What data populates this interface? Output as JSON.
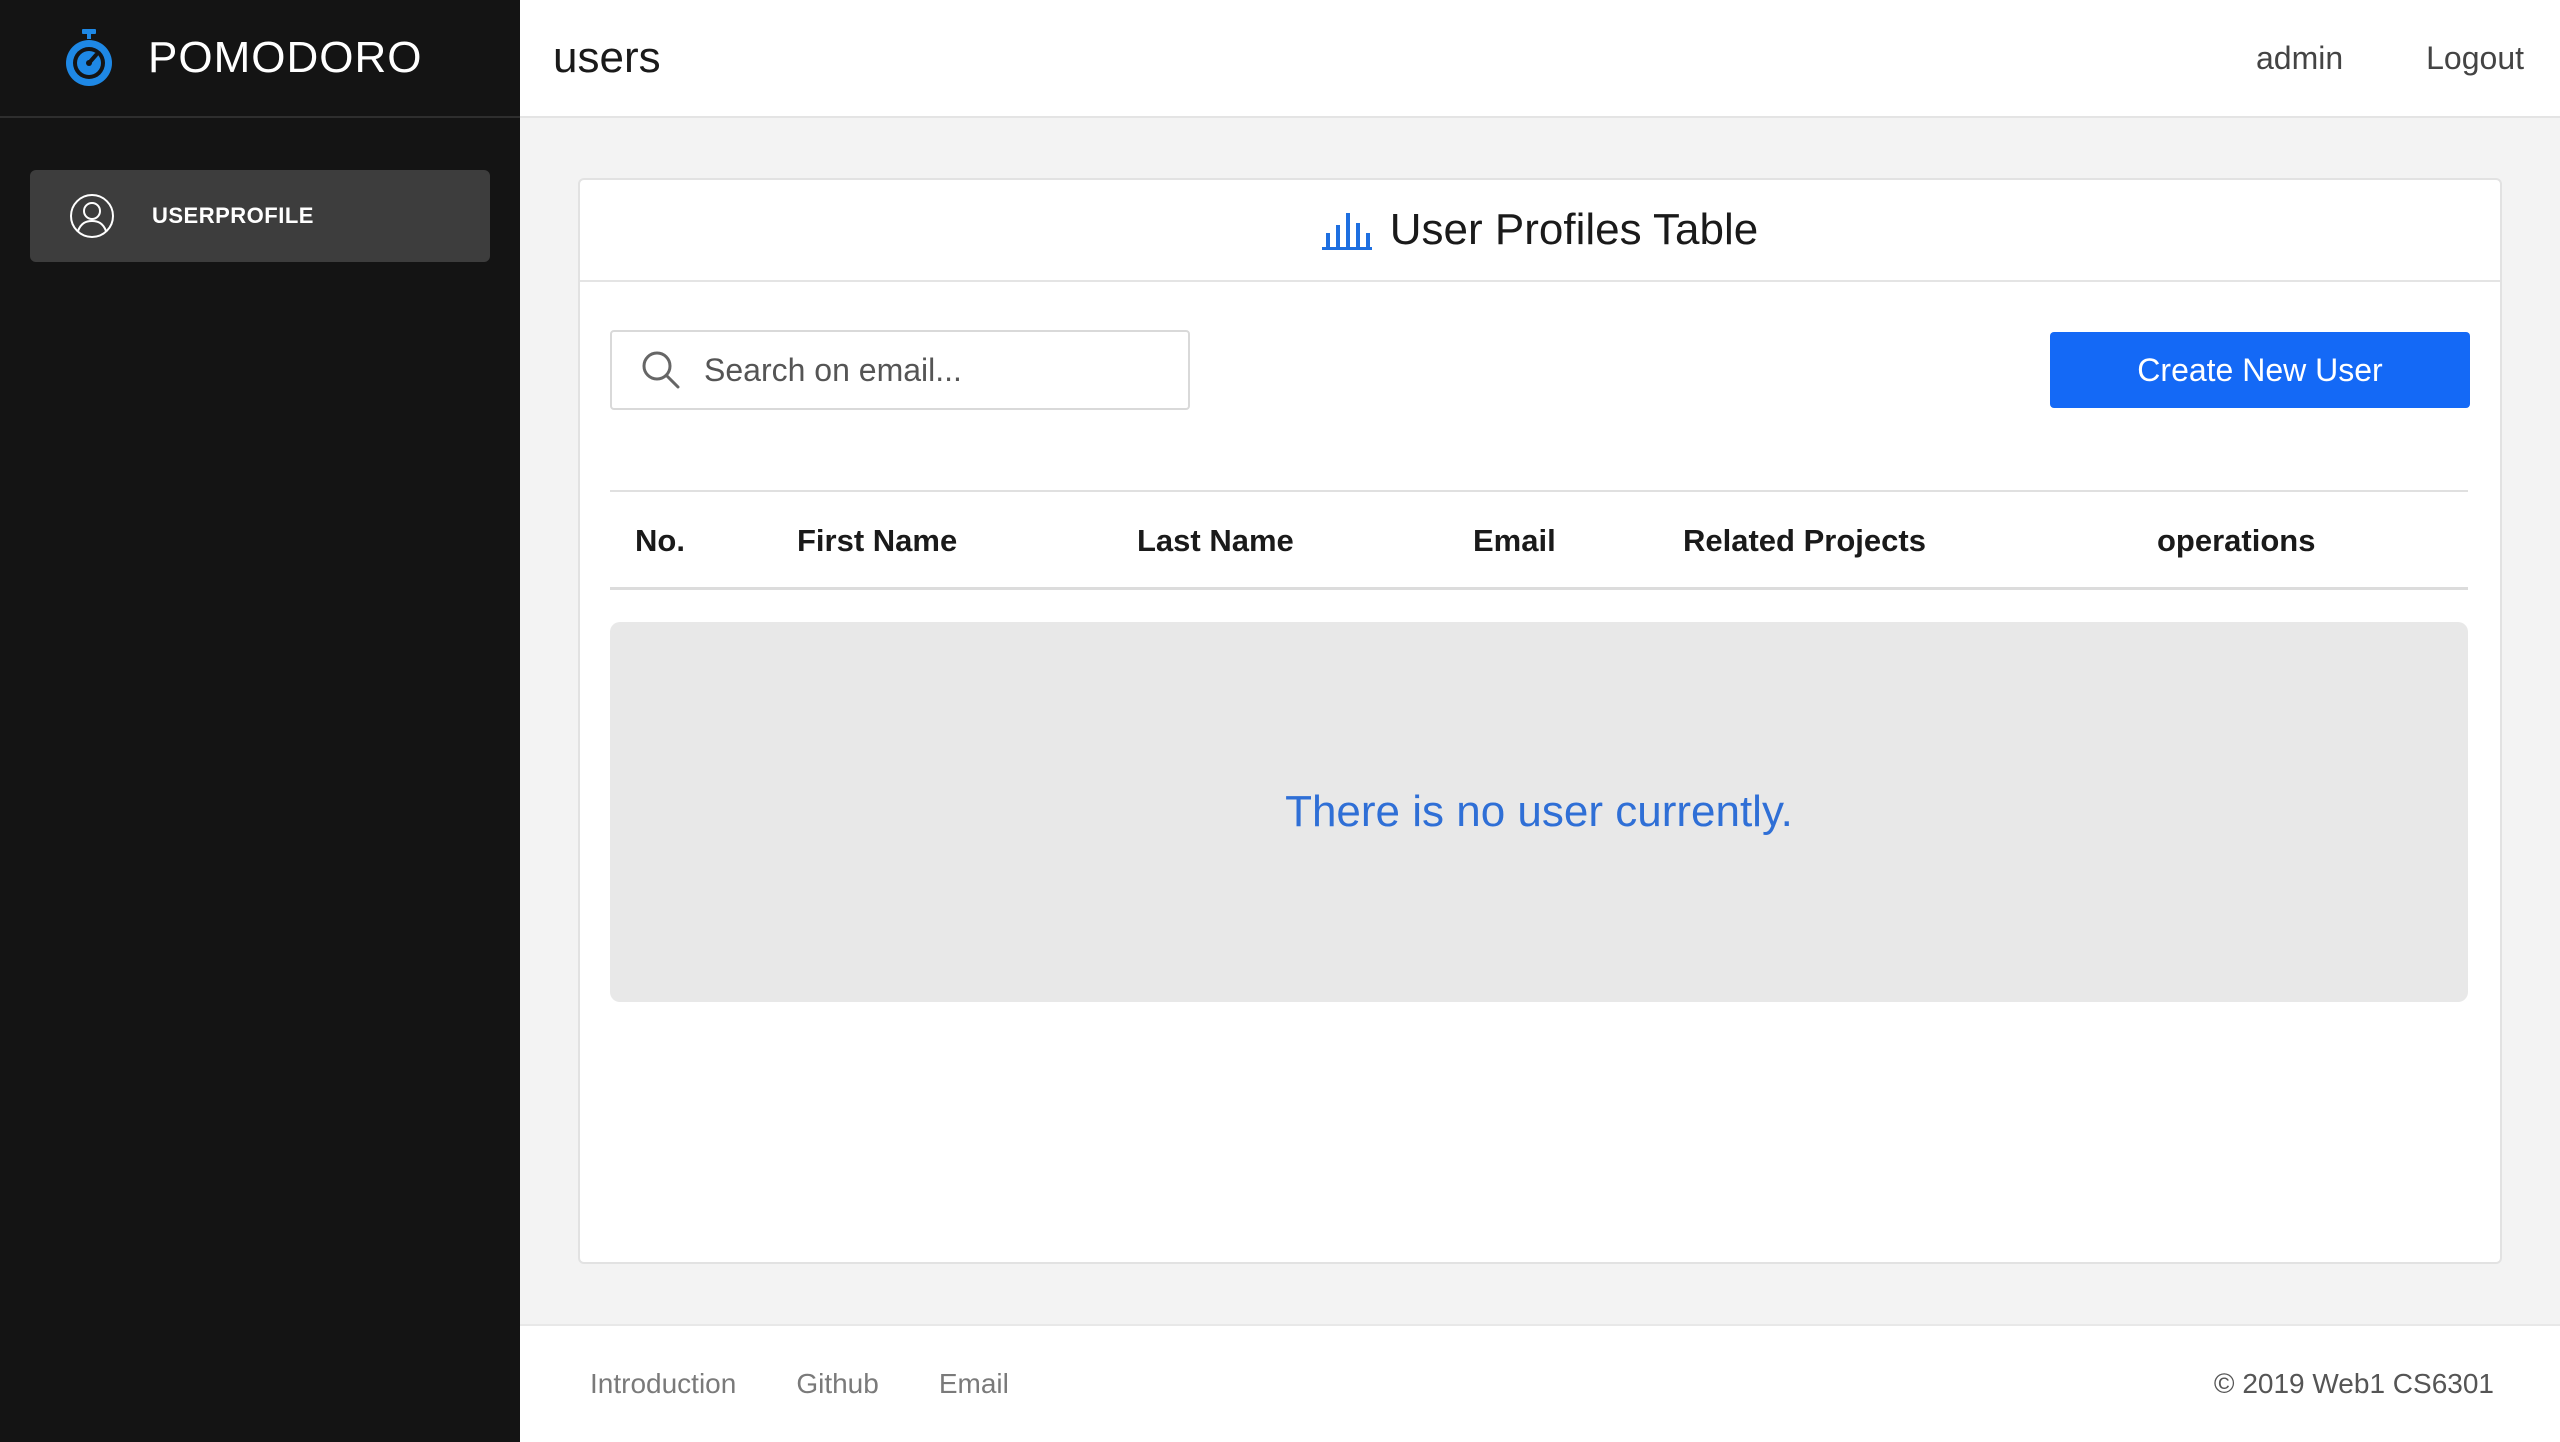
{
  "sidebar": {
    "brand": {
      "name": "POMODORO",
      "icon": "stopwatch-icon"
    },
    "items": [
      {
        "label": "USERPROFILE",
        "icon": "user-circle-icon",
        "active": true
      }
    ]
  },
  "header": {
    "title": "users",
    "user": "admin",
    "logout": "Logout"
  },
  "card": {
    "icon": "bar-chart-icon",
    "title": "User Profiles Table",
    "search": {
      "placeholder": "Search on email...",
      "value": "",
      "icon": "search-icon"
    },
    "create_button": "Create New User",
    "table": {
      "columns": [
        "No.",
        "First Name",
        "Last Name",
        "Email",
        "Related Projects",
        "operations"
      ],
      "rows": []
    },
    "empty_message": "There is no user currently."
  },
  "footer": {
    "links": [
      "Introduction",
      "Github",
      "Email"
    ],
    "copyright": "© 2019 Web1 CS6301"
  },
  "colors": {
    "sidebar_bg": "#141414",
    "accent": "#1469f6",
    "brand_icon": "#1e88e5",
    "empty_text": "#2f6fd6"
  }
}
